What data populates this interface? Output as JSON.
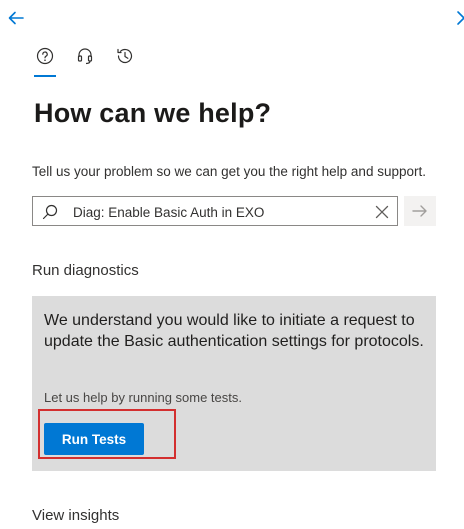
{
  "header": {
    "back_icon": "arrow-left-icon",
    "close_icon": "close-icon"
  },
  "nav_tabs": [
    {
      "name": "help",
      "icon": "question-circle-icon",
      "active": true
    },
    {
      "name": "contact-support",
      "icon": "headset-icon",
      "active": false
    },
    {
      "name": "history",
      "icon": "history-icon",
      "active": false
    }
  ],
  "main": {
    "title": "How can we help?",
    "subtitle": "Tell us your problem so we can get you the right help and support.",
    "search": {
      "value": "Diag: Enable Basic Auth in EXO",
      "placeholder": ""
    }
  },
  "diagnostics": {
    "section_title": "Run diagnostics",
    "message": "We understand you would like to initiate a request to update the Basic authentication settings for protocols.",
    "hint": "Let us help by running some tests.",
    "button_label": "Run Tests"
  },
  "insights": {
    "section_title": "View insights"
  },
  "colors": {
    "accent": "#0078d4",
    "highlight_border": "#d32f2f",
    "card_background": "#dcdcdc"
  }
}
